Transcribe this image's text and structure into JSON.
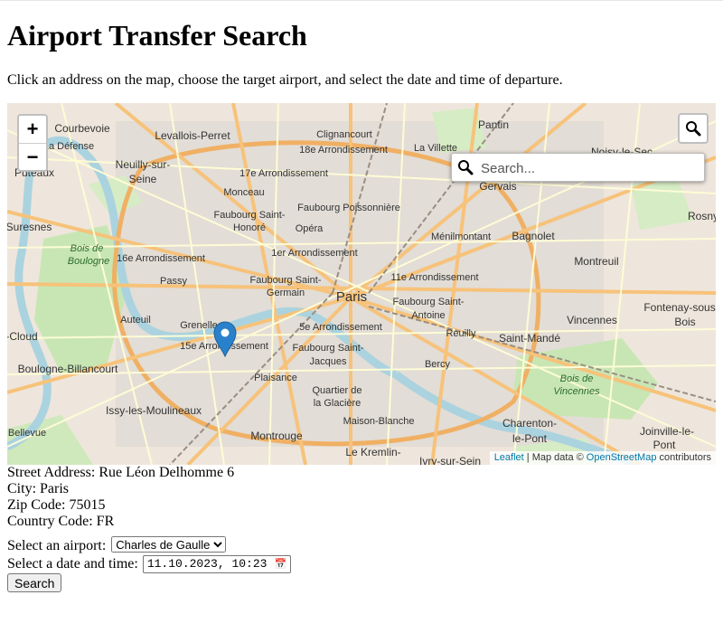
{
  "page": {
    "title": "Airport Transfer Search",
    "intro": "Click an address on the map, choose the target airport, and select the date and time of departure."
  },
  "map": {
    "zoom_in": "+",
    "zoom_out": "−",
    "search_placeholder": "Search...",
    "attribution": {
      "leaflet": "Leaflet",
      "separator": "| Map data ©",
      "osm": "OpenStreetMap",
      "contributors": "contributors"
    },
    "labels": [
      "Pantin",
      "Courbevoie",
      "Levallois-Perret",
      "Clignancourt",
      "La Villette",
      "La Défense",
      "18e Arrondissement",
      "Noisy-le-Sec",
      "Puteaux",
      "Neuilly-sur-",
      "Seine",
      "17e Arrondissement",
      "Gervais",
      "Monceau",
      "Faubourg Poissonnière",
      "Faubourg Saint-",
      "Honoré",
      "Opéra",
      "Suresnes",
      "Bois de",
      "Boulogne",
      "Ménilmontant",
      "Bagnolet",
      "Rosny",
      "16e Arrondissement",
      "1er Arrondissement",
      "Passy",
      "Faubourg Saint-",
      "Germain",
      "11e Arrondissement",
      "Montreuil",
      "Paris",
      "Faubourg Saint-",
      "Antoine",
      "Auteuil",
      "Grenelle",
      "5e Arrondissement",
      "Vincennes",
      "Fontenay-sous-",
      "Bois",
      "-Cloud",
      "15e Arrondissement",
      "Faubourg Saint-",
      "Jacques",
      "Reuilly",
      "Saint-Mandé",
      "Boulogne-Billancourt",
      "Plaisance",
      "Bercy",
      "Quartier de",
      "la Glacière",
      "Bois de",
      "Vincennes",
      "Issy-les-Moulineaux",
      "Maison-Blanche",
      "Charenton-",
      "le-Pont",
      "Montrouge",
      "Joinville-le-",
      "Pont",
      "Bellevue",
      "Le Kremlin-",
      "Ivry-sur-Sein"
    ]
  },
  "address": {
    "street": "Street Address: Rue Léon Delhomme 6",
    "city": "City: Paris",
    "zip": "Zip Code: 75015",
    "country": "Country Code: FR"
  },
  "form": {
    "airport_label": "Select an airport:",
    "airport_value": "Charles de Gaulle",
    "datetime_label": "Select a date and time:",
    "datetime_value": "11.10.2023, 10:23",
    "search_button": "Search"
  },
  "colors": {
    "marker": "#2a81cb",
    "link": "#0078a8",
    "park": "#c8e6b4",
    "water": "#aad3df",
    "major_road": "#f7c27a",
    "minor_road": "#fdfcd6",
    "rail": "#9a8e82"
  }
}
